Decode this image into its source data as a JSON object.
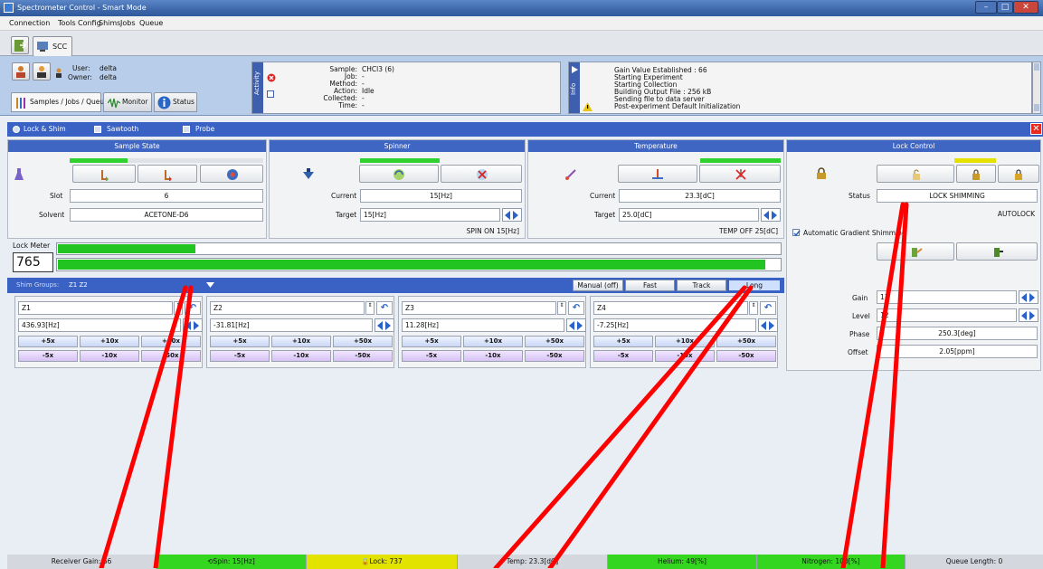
{
  "window": {
    "title": "Spectrometer Control - Smart Mode"
  },
  "menu": [
    "Connection",
    "Tools",
    "Config",
    "Shims",
    "Jobs",
    "Queue"
  ],
  "top_tab": "SCC",
  "user": {
    "user_label": "User:",
    "user": "delta",
    "owner_label": "Owner:",
    "owner": "delta"
  },
  "nav_tabs": [
    "Samples / Jobs / Queue",
    "Monitor",
    "Status"
  ],
  "activity": {
    "side_label": "Activity",
    "rows": [
      {
        "label": "Sample:",
        "value": "CHCl3 (6)"
      },
      {
        "label": "Job:",
        "value": "-"
      },
      {
        "label": "Method:",
        "value": "-"
      },
      {
        "label": "Action:",
        "value": "Idle"
      },
      {
        "label": "Collected:",
        "value": "-"
      },
      {
        "label": "Time:",
        "value": "-"
      }
    ]
  },
  "info": {
    "side_label": "Info",
    "lines": [
      "Gain Value Established : 66",
      "Starting Experiment",
      "Starting Collection",
      "Building Output File : 256 kB",
      "Sending file to data server",
      "Post-experiment Default Initialization"
    ]
  },
  "mode_bar": {
    "lock_shim": "Lock & Shim",
    "sawtooth": "Sawtooth",
    "probe": "Probe"
  },
  "sample_state": {
    "title": "Sample State",
    "slot_label": "Slot",
    "slot": "6",
    "solvent_label": "Solvent",
    "solvent": "ACETONE-D6",
    "level_fraction": 0.3
  },
  "spinner": {
    "title": "Spinner",
    "current_label": "Current",
    "current": "15[Hz]",
    "target_label": "Target",
    "target": "15[Hz]",
    "status": "SPIN ON 15[Hz]"
  },
  "temperature": {
    "title": "Temperature",
    "current_label": "Current",
    "current": "23.3[dC]",
    "target_label": "Target",
    "target": "25.0[dC]",
    "status": "TEMP OFF 25[dC]"
  },
  "lock_control": {
    "title": "Lock Control",
    "status_label": "Status",
    "status": "LOCK SHIMMING",
    "autolock": "AUTOLOCK",
    "auto_gradient": "Automatic Gradient Shimming",
    "gain_label": "Gain",
    "gain": "11",
    "level_label": "Level",
    "level": "12",
    "phase_label": "Phase",
    "phase": "250.3[deg]",
    "offset_label": "Offset",
    "offset": "2.05[ppm]"
  },
  "lock_meter": {
    "label": "Lock Meter",
    "value": "765",
    "upper_fraction": 0.19,
    "lower_fraction": 0.98
  },
  "shim": {
    "group_label": "Shim Groups:",
    "group_value": "Z1 Z2",
    "modes": [
      "Manual (off)",
      "Fast",
      "Track",
      "Long"
    ],
    "boxes": [
      {
        "name": "Z1",
        "value": "436.93[Hz]"
      },
      {
        "name": "Z2",
        "value": "-31.81[Hz]"
      },
      {
        "name": "Z3",
        "value": "11.28[Hz]"
      },
      {
        "name": "Z4",
        "value": "-7.25[Hz]"
      }
    ],
    "plus": [
      "+5x",
      "+10x",
      "+50x"
    ],
    "minus": [
      "-5x",
      "-10x",
      "-50x"
    ]
  },
  "statusbar": [
    "Receiver Gain: 66",
    "Spin: 15[Hz]",
    "Lock: 737",
    "Temp: 23.3[dC]",
    "Helium: 49[%]",
    "Nitrogen: 100[%]",
    "Queue Length: 0"
  ],
  "colors": {
    "accent": "#3a62c4",
    "ok": "#2fd22f",
    "warn": "#e4e000",
    "alert": "#ff0000"
  }
}
